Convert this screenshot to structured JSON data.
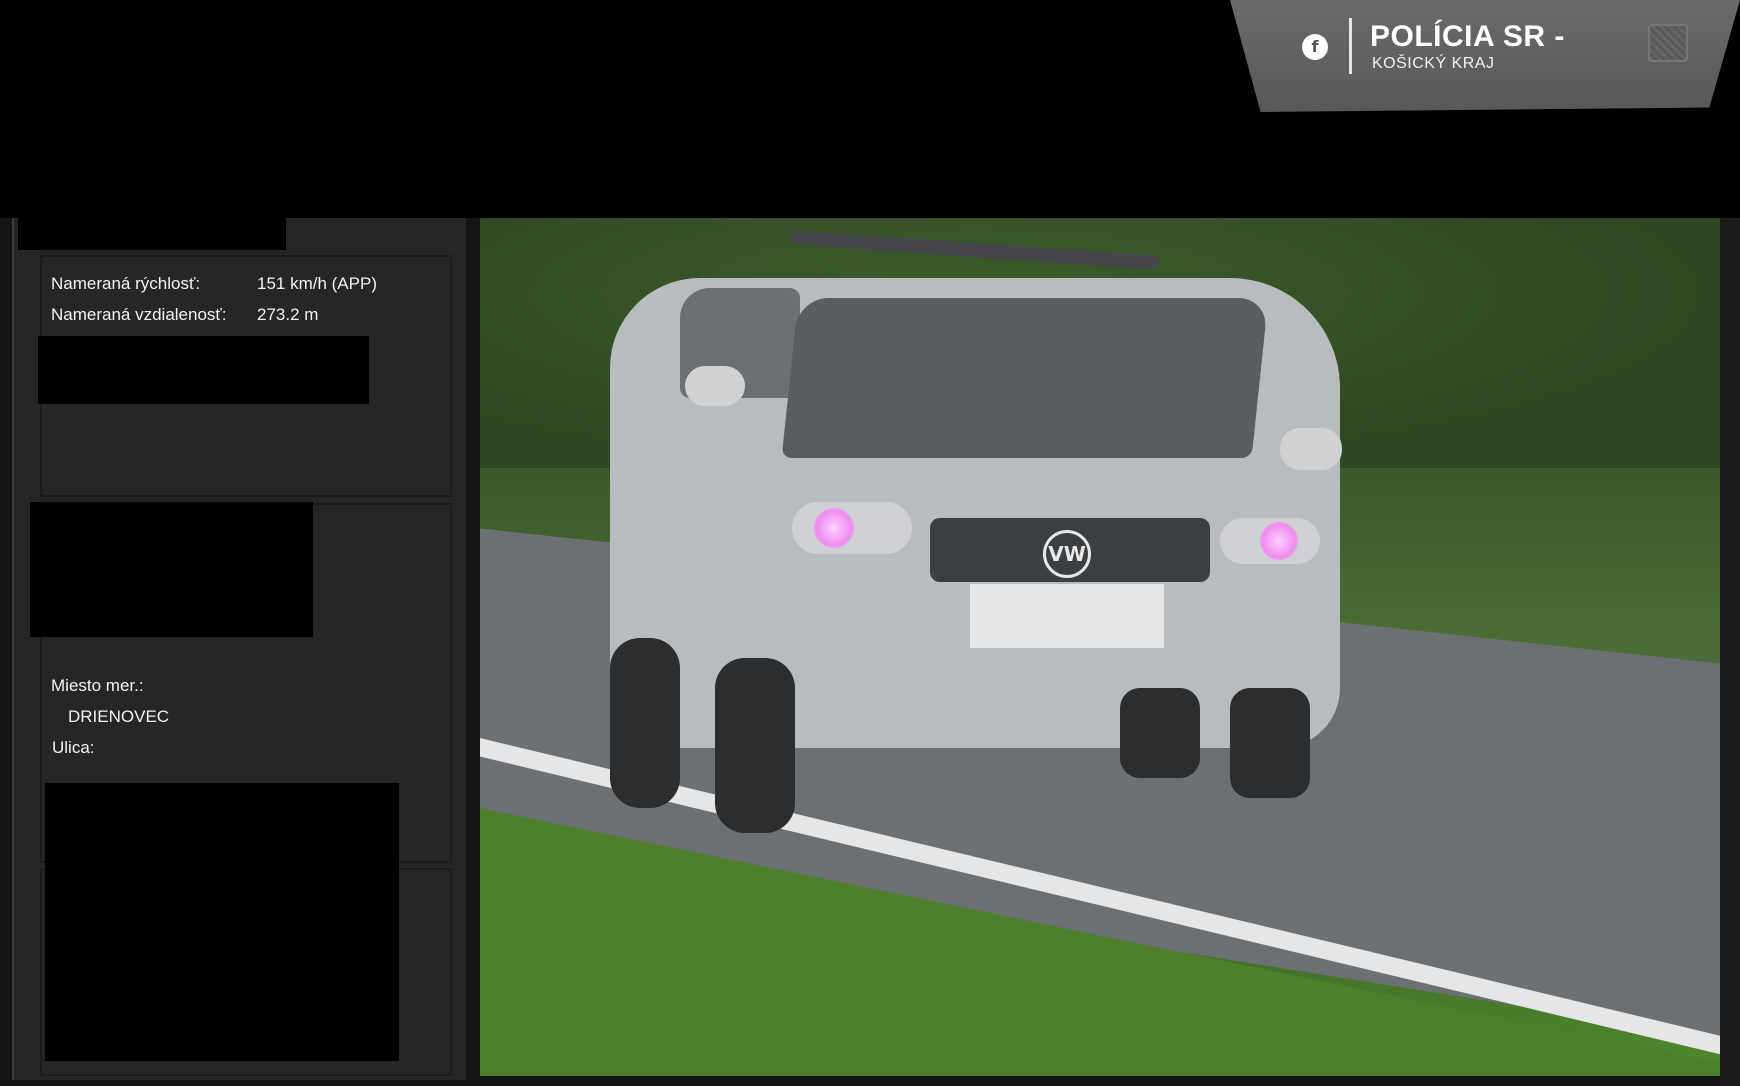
{
  "badge": {
    "title": "POLÍCIA SR -",
    "subtitle": "KOŠICKÝ KRAJ",
    "icon": "facebook-icon"
  },
  "measurement": {
    "speed_label": "Nameraná rýchlosť:",
    "speed_value": "151 km/h (APP)",
    "distance_label": "Nameraná vzdialenosť:",
    "distance_value": "273.2 m"
  },
  "location": {
    "place_label": "Miesto mer.:",
    "place_value": "DRIENOVEC",
    "street_label": "Ulica:"
  },
  "photo": {
    "car_logo": "VW"
  }
}
